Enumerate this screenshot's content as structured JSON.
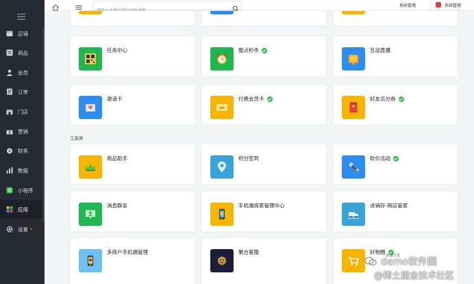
{
  "sidebar": {
    "items": [
      {
        "label": "店铺",
        "icon": "store-icon"
      },
      {
        "label": "商品",
        "icon": "goods-icon"
      },
      {
        "label": "会员",
        "icon": "member-icon"
      },
      {
        "label": "订单",
        "icon": "order-icon"
      },
      {
        "label": "门店",
        "icon": "shop-icon"
      },
      {
        "label": "营销",
        "icon": "gift-icon"
      },
      {
        "label": "财务",
        "icon": "finance-icon"
      },
      {
        "label": "数据",
        "icon": "chart-icon"
      },
      {
        "label": "小程序",
        "icon": "miniprogram-icon"
      },
      {
        "label": "应用",
        "icon": "apps-icon"
      },
      {
        "label": "设置",
        "icon": "gear-icon"
      }
    ],
    "active": "应用"
  },
  "topbar": {
    "search_placeholder": "请输入关键词进行功能搜索...",
    "system_manage": "系统管理",
    "system_manage_2": "系统管理"
  },
  "sections": {
    "tools_title": "工具类"
  },
  "cards": [
    {
      "title": "任务中心",
      "verified": false,
      "color": "#1fb84e"
    },
    {
      "title": "整点秒杀",
      "verified": true,
      "color": "#1fb84e"
    },
    {
      "title": "互动直播",
      "verified": false,
      "color": "#2d8ef0"
    },
    {
      "title": "邀请卡",
      "verified": false,
      "color": "#2d8ef0"
    },
    {
      "title": "付费会员卡",
      "verified": true,
      "color": "#f7b500"
    },
    {
      "title": "好友瓜分券",
      "verified": true,
      "color": "#f7b500"
    },
    {
      "title": "商品助手",
      "verified": false,
      "color": "#f7b500"
    },
    {
      "title": "积分签到",
      "verified": false,
      "color": "#3aa3d8"
    },
    {
      "title": "砍价活动",
      "verified": true,
      "color": "#2d8ef0"
    },
    {
      "title": "消息群发",
      "verified": false,
      "color": "#1fb84e"
    },
    {
      "title": "手机端商家管理中心",
      "verified": false,
      "color": "#f7b500"
    },
    {
      "title": "进销存-网店管家",
      "verified": false,
      "color": "#3aa3d8"
    },
    {
      "title": "多商户手机端管理",
      "verified": false,
      "color": "#6ec0f0"
    },
    {
      "title": "聚合客服",
      "verified": false,
      "color": "#1b1f3a"
    },
    {
      "title": "好物圈",
      "verified": true,
      "color": "#f7b500"
    }
  ],
  "watermark": {
    "line1": "demo软件园",
    "line2": "@稀土掘金技术社区",
    "small": "的源分享"
  }
}
